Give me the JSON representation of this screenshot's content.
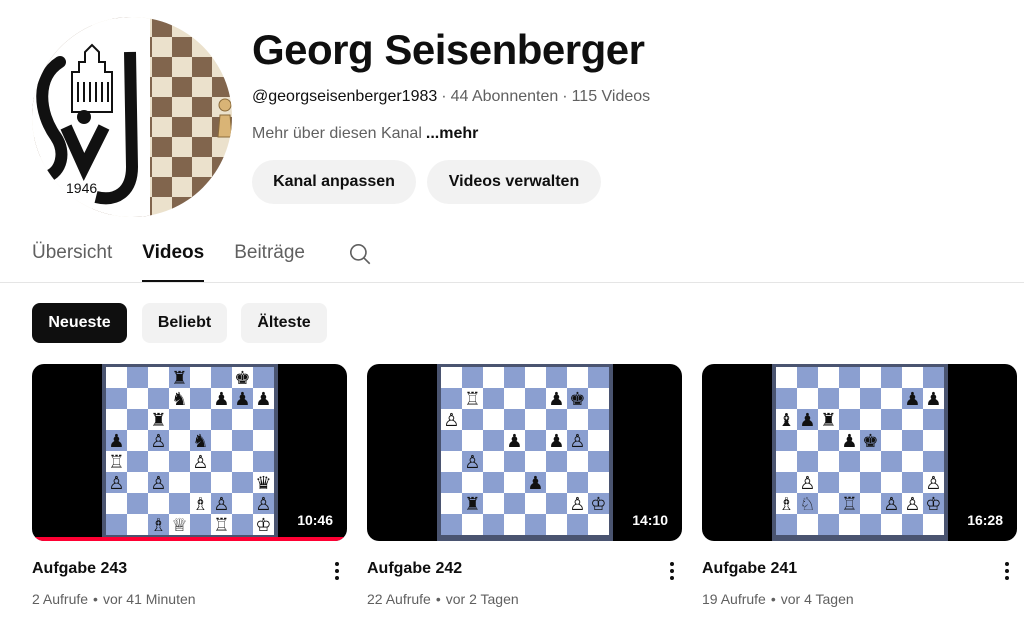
{
  "channel": {
    "name": "Georg Seisenberger",
    "handle": "@georgseisenberger1983",
    "subscribers": "44 Abonnenten",
    "video_count": "115 Videos",
    "separator": "·",
    "about_text": "Mehr über diesen Kanal",
    "more_label": "...mehr",
    "avatar_year": "1946"
  },
  "buttons": {
    "customize": "Kanal anpassen",
    "manage": "Videos verwalten"
  },
  "tabs": [
    {
      "label": "Übersicht",
      "active": false
    },
    {
      "label": "Videos",
      "active": true
    },
    {
      "label": "Beiträge",
      "active": false
    }
  ],
  "chips": [
    {
      "label": "Neueste",
      "selected": true
    },
    {
      "label": "Beliebt",
      "selected": false
    },
    {
      "label": "Älteste",
      "selected": false
    }
  ],
  "videos": [
    {
      "title": "Aufgabe 243",
      "views": "2 Aufrufe",
      "age": "vor 41 Minuten",
      "duration": "10:46",
      "watched": true
    },
    {
      "title": "Aufgabe 242",
      "views": "22 Aufrufe",
      "age": "vor 2 Tagen",
      "duration": "14:10",
      "watched": false
    },
    {
      "title": "Aufgabe 241",
      "views": "19 Aufrufe",
      "age": "vor 4 Tagen",
      "duration": "16:28",
      "watched": false
    }
  ],
  "meta_dot": "•",
  "colors": {
    "accent_progress": "#ff0033",
    "board_light": "#ffffff",
    "board_dark": "#8b9fd0",
    "chip_selected_bg": "#0f0f0f",
    "chip_bg": "#f2f2f2",
    "secondary_text": "#606060"
  },
  "icons": {
    "search": "search-icon",
    "more": "more-vert-icon"
  }
}
